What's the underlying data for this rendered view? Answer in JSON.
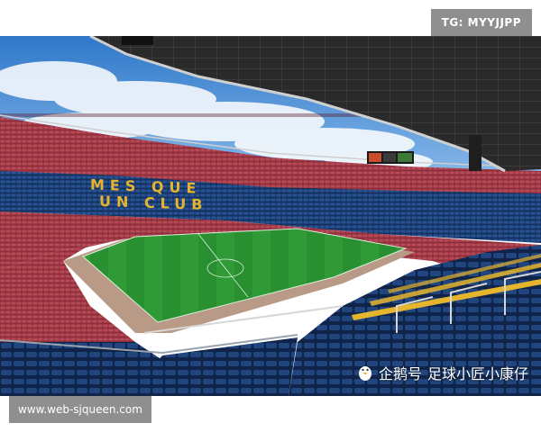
{
  "tag_badge": "TG: MYYJJPP",
  "stand_lettering": {
    "line1": "MES QUE",
    "line2": "UN CLUB"
  },
  "watermark": {
    "platform": "企鹅号",
    "author": "足球小匠小康仔",
    "icon": "penguin-icon"
  },
  "footer_url": "www.web-sjqueen.com",
  "colors": {
    "pitch": "#2f9a36",
    "seat_blue": "#1d3f7e",
    "seat_red": "#a83c4a",
    "seat_yellow": "#e6b52e",
    "sky": "#3f86d4",
    "roof": "#242424"
  }
}
